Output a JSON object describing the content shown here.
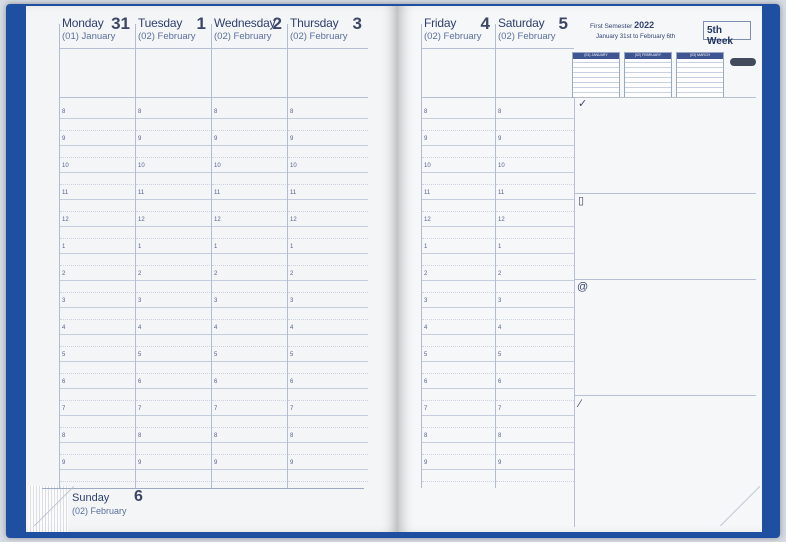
{
  "days": [
    {
      "name": "Monday",
      "num": "31",
      "sub": "(01) January"
    },
    {
      "name": "Tuesday",
      "num": "1",
      "sub": "(02) February"
    },
    {
      "name": "Wednesday",
      "num": "2",
      "sub": "(02) February"
    },
    {
      "name": "Thursday",
      "num": "3",
      "sub": "(02) February"
    },
    {
      "name": "Friday",
      "num": "4",
      "sub": "(02) February"
    },
    {
      "name": "Saturday",
      "num": "5",
      "sub": "(02) February"
    }
  ],
  "sunday": {
    "name": "Sunday",
    "num": "6",
    "sub": "(02) February"
  },
  "hours": [
    "8",
    "9",
    "10",
    "11",
    "12",
    "1",
    "2",
    "3",
    "4",
    "5",
    "6",
    "7",
    "8",
    "9"
  ],
  "calendar": {
    "title_prefix": "First Semester",
    "year": "2022",
    "range": "January 31st to February 6th",
    "week": "5th Week",
    "months": [
      "(01) JANUARY",
      "(02) FEBRUARY",
      "(03) MARCH"
    ]
  },
  "panel_icons": [
    "check-icon",
    "phone-icon",
    "at-sign-icon",
    "pen-icon"
  ]
}
